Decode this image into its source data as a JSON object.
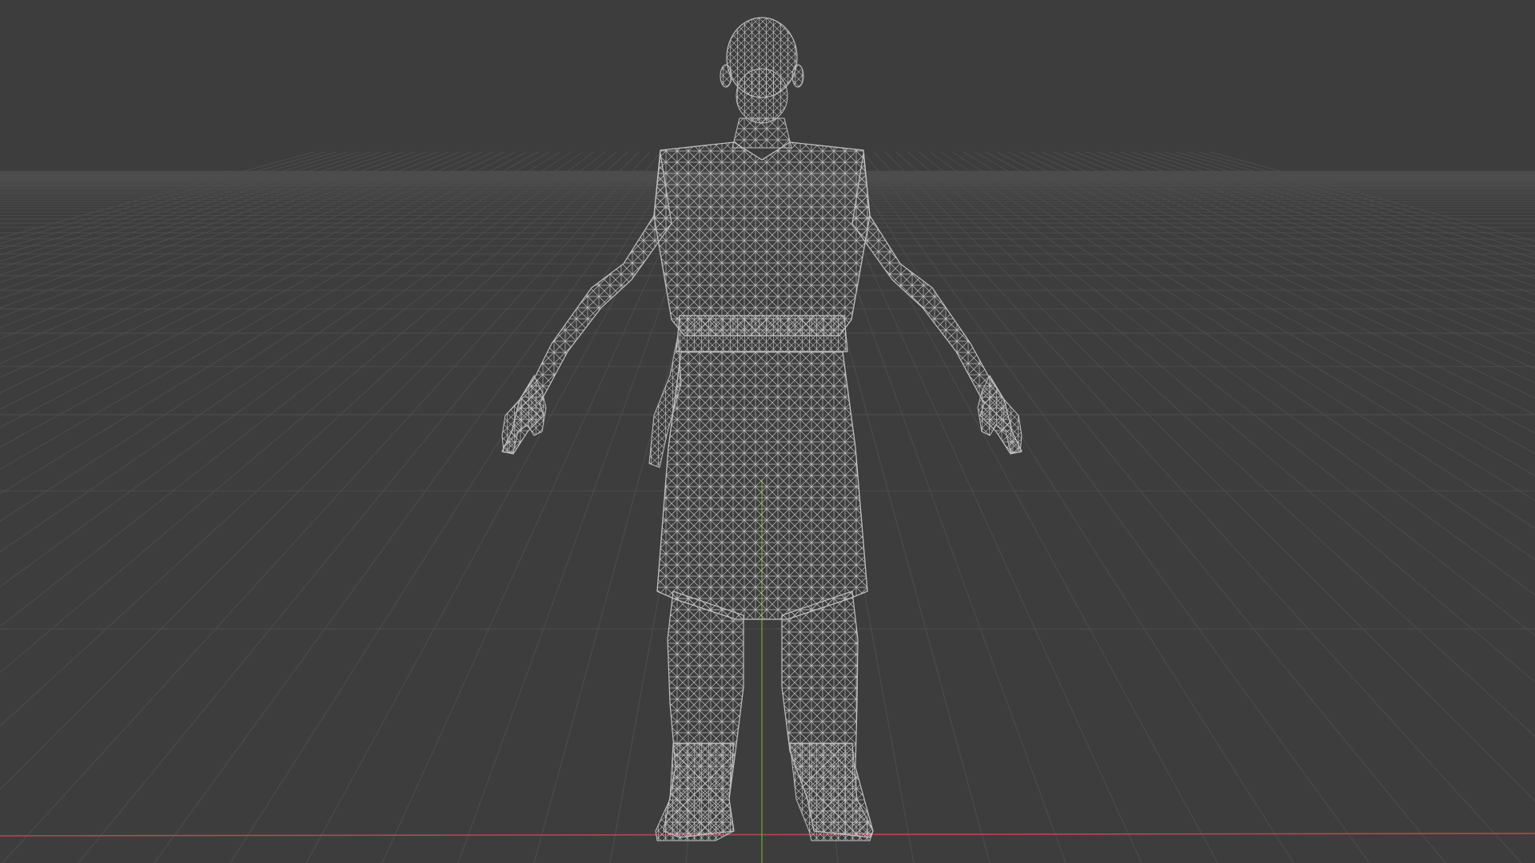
{
  "viewport": {
    "background_color": "#3d3d3d",
    "grid_color": "#4d4d4d",
    "x_axis_color": "#b4484f",
    "y_axis_color": "#6b9a2f",
    "wireframe_color": "#bdbdbd"
  },
  "scene": {
    "object": "humanoid-wireframe-mesh",
    "pose": "A-pose",
    "view": "front-perspective",
    "shading_mode": "wireframe"
  }
}
